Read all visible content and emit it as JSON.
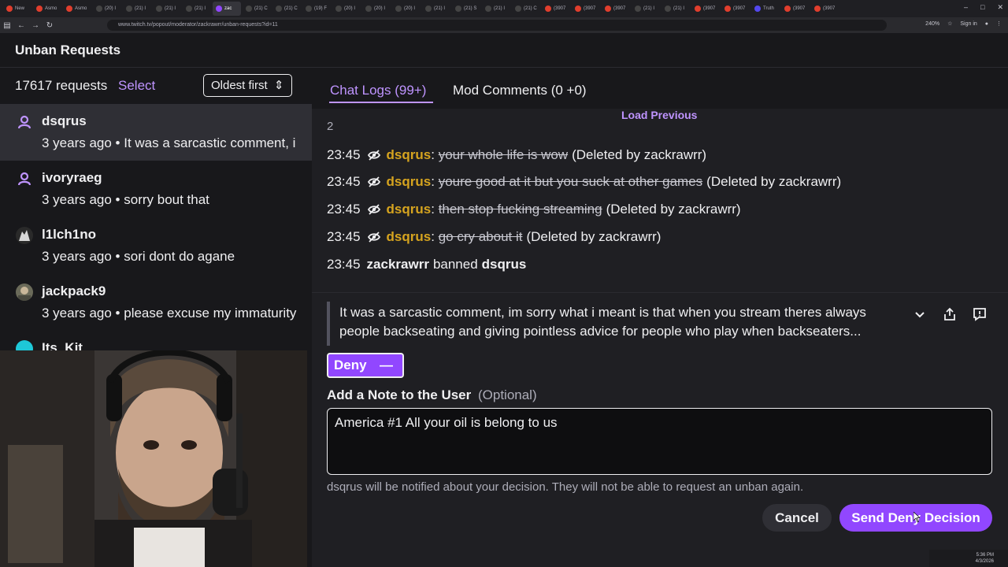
{
  "browser": {
    "tabs": [
      {
        "label": "New",
        "color": "#e03e2d"
      },
      {
        "label": "Asmo",
        "color": "#e03e2d"
      },
      {
        "label": "Asmo",
        "color": "#e03e2d"
      },
      {
        "label": "(20) I",
        "color": "#444"
      },
      {
        "label": "(21) I",
        "color": "#444"
      },
      {
        "label": "(21) I",
        "color": "#444"
      },
      {
        "label": "(21) I",
        "color": "#444"
      },
      {
        "label": "zac",
        "color": "#9147ff"
      },
      {
        "label": "(21) C",
        "color": "#444"
      },
      {
        "label": "(21) C",
        "color": "#444"
      },
      {
        "label": "(19) F",
        "color": "#444"
      },
      {
        "label": "(20) I",
        "color": "#444"
      },
      {
        "label": "(20) I",
        "color": "#444"
      },
      {
        "label": "(20) I",
        "color": "#444"
      },
      {
        "label": "(21) I",
        "color": "#444"
      },
      {
        "label": "(21) S",
        "color": "#444"
      },
      {
        "label": "(21) I",
        "color": "#444"
      },
      {
        "label": "(21) C",
        "color": "#444"
      },
      {
        "label": "(3907",
        "color": "#e03e2d"
      },
      {
        "label": "(3907",
        "color": "#e03e2d"
      },
      {
        "label": "(3907",
        "color": "#e03e2d"
      },
      {
        "label": "(21) I",
        "color": "#444"
      },
      {
        "label": "(21) I",
        "color": "#444"
      },
      {
        "label": "(3907",
        "color": "#e03e2d"
      },
      {
        "label": "(3907",
        "color": "#e03e2d"
      },
      {
        "label": "Truth",
        "color": "#5448ee"
      },
      {
        "label": "(3907",
        "color": "#e03e2d"
      },
      {
        "label": "(3907",
        "color": "#e03e2d"
      }
    ],
    "url": "www.twitch.tv/popout/moderator/zackrawrr/unban-requests?id=11",
    "zoom": "240%",
    "sign_in": "Sign in"
  },
  "header": {
    "title": "Unban Requests"
  },
  "left": {
    "count": "17617 requests",
    "select": "Select",
    "sort": "Oldest first",
    "requests": [
      {
        "name": "dsqrus",
        "sub": "3 years ago • It was a sarcastic comment, i"
      },
      {
        "name": "ivoryraeg",
        "sub": "3 years ago • sorry bout that"
      },
      {
        "name": "l1lch1no",
        "sub": "3 years ago • sori dont do agane"
      },
      {
        "name": "jackpack9",
        "sub": "3 years ago • please excuse my immaturity"
      },
      {
        "name": "Its_Kit",
        "sub": ""
      }
    ]
  },
  "right": {
    "tab_logs": "Chat Logs (99+)",
    "tab_mod": "Mod Comments (0 +0)",
    "load_previous": "Load Previous",
    "log_partial": "2",
    "logs": [
      {
        "time": "23:45",
        "user": "dsqrus",
        "msg": "your whole life is wow",
        "note": "(Deleted by zackrawrr)"
      },
      {
        "time": "23:45",
        "user": "dsqrus",
        "msg": "youre good at it but you suck at other games",
        "note": "(Deleted by zackrawrr)"
      },
      {
        "time": "23:45",
        "user": "dsqrus",
        "msg": "then stop fucking streaming",
        "note": "(Deleted by zackrawrr)"
      },
      {
        "time": "23:45",
        "user": "dsqrus",
        "msg": "go cry about it",
        "note": "(Deleted by zackrawrr)"
      }
    ],
    "ban_line": {
      "time": "23:45",
      "mod": "zackrawrr",
      "action": "banned",
      "target": "dsqrus"
    },
    "request_text": "It was a sarcastic comment, im sorry what i meant is that when you stream theres always people backseating and giving pointless advice for people who play when backseaters...",
    "decision": "Deny",
    "note_title": "Add a Note to the User",
    "note_optional": "(Optional)",
    "note_value": "America #1 All your oil is belong to us",
    "notify_text": "dsqrus will be notified about your decision. They will not be able to request an unban again.",
    "cancel": "Cancel",
    "send": "Send Deny Decision"
  },
  "taskbar": {
    "time": "5:36 PM",
    "date": "4/3/2026"
  },
  "colors": {
    "accent": "#9147ff",
    "accent_text": "#bf94ff",
    "chat_user": "#d6a41f"
  }
}
